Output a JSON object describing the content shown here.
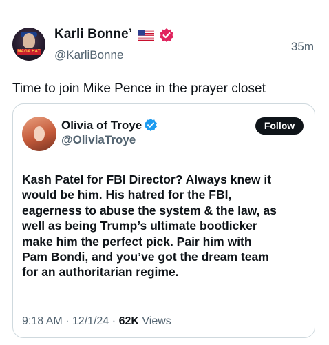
{
  "post": {
    "author_name": "Karli Bonne’",
    "author_handle": "@KarliBonne",
    "time_ago": "35m",
    "text": "Time to join Mike Pence in the prayer closet",
    "avatar_label": "MAGA HAT"
  },
  "quoted": {
    "author_name": "Olivia of Troye",
    "author_handle": "@OliviaTroye",
    "follow_label": "Follow",
    "lines": [
      "Kash Patel for FBI Director? Always knew it",
      "would be him. His hatred for the FBI,",
      "eagerness to abuse the system & the law, as",
      "well as being Trump’s ultimate bootlicker",
      "make him the perfect pick. Pair him with",
      "Pam Bondi, and you’ve got the dream team",
      "for an authoritarian regime."
    ],
    "time": "9:18 AM",
    "date": "12/1/24",
    "views_count": "62K",
    "views_label": "Views",
    "separator": "·"
  },
  "colors": {
    "verified_pink": "#e0245e",
    "verified_blue": "#1d9bf0",
    "secondary_text": "#536471",
    "primary_text": "#0f1419",
    "border": "#cfd9de"
  },
  "icons": {
    "flag": "us-flag-icon",
    "pink_badge": "verified-badge-pink-icon",
    "blue_badge": "verified-badge-blue-icon"
  }
}
